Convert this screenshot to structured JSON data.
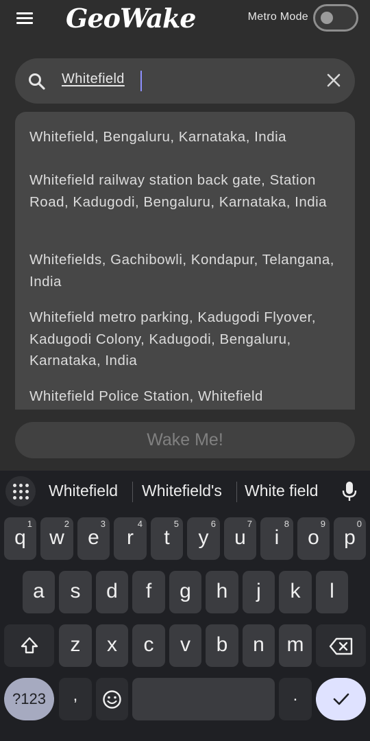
{
  "header": {
    "app_title": "GeoWake",
    "metro_mode_label": "Metro Mode",
    "metro_mode_on": false
  },
  "search": {
    "value": "Whitefield"
  },
  "suggestions": [
    "Whitefield, Bengaluru, Karnataka, India",
    "Whitefield railway station back gate, Station Road, Kadugodi, Bengaluru, Karnataka, India",
    "Whitefields, Gachibowli, Kondapur, Telangana, India",
    "Whitefield metro parking, Kadugodi Flyover, Kadugodi Colony, Kadugodi, Bengaluru, Karnataka, India",
    "Whitefield Police Station, Whitefield"
  ],
  "wake_button_label": "Wake Me!",
  "keyboard": {
    "word_suggestions": [
      "Whitefield",
      "Whitefield's",
      "White field"
    ],
    "row1": [
      {
        "key": "q",
        "num": "1"
      },
      {
        "key": "w",
        "num": "2"
      },
      {
        "key": "e",
        "num": "3"
      },
      {
        "key": "r",
        "num": "4"
      },
      {
        "key": "t",
        "num": "5"
      },
      {
        "key": "y",
        "num": "6"
      },
      {
        "key": "u",
        "num": "7"
      },
      {
        "key": "i",
        "num": "8"
      },
      {
        "key": "o",
        "num": "9"
      },
      {
        "key": "p",
        "num": "0"
      }
    ],
    "row2": [
      "a",
      "s",
      "d",
      "f",
      "g",
      "h",
      "j",
      "k",
      "l"
    ],
    "row3": [
      "z",
      "x",
      "c",
      "v",
      "b",
      "n",
      "m"
    ],
    "symbols_label": "?123",
    "comma_label": ",",
    "period_label": "."
  },
  "colors": {
    "background": "#2e2e2e",
    "search_bg": "#444444",
    "keyboard_bg": "#1f2024",
    "enter_key": "#dfe2ff",
    "caret": "#8e90ff"
  }
}
